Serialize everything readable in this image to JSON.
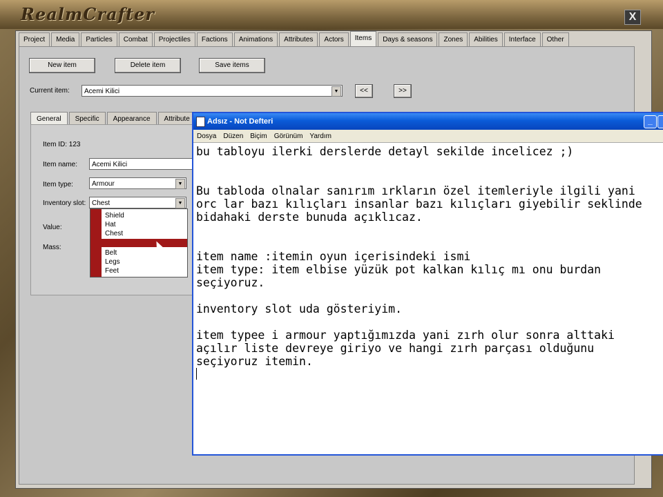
{
  "app": {
    "logo_text": "RealmCrafter",
    "close_glyph": "X"
  },
  "main_tabs": [
    "Project",
    "Media",
    "Particles",
    "Combat",
    "Projectiles",
    "Factions",
    "Animations",
    "Attributes",
    "Actors",
    "Items",
    "Days & seasons",
    "Zones",
    "Abilities",
    "Interface",
    "Other"
  ],
  "active_main_tab": "Items",
  "toolbar": {
    "new_item": "New item",
    "delete_item": "Delete item",
    "save_items": "Save items"
  },
  "current_item": {
    "label": "Current item:",
    "value": "Acemi Kilici",
    "prev": "<<",
    "next": ">>"
  },
  "sub_tabs": [
    "General",
    "Specific",
    "Appearance",
    "Attribute"
  ],
  "active_sub_tab": "General",
  "general": {
    "item_id": "Item ID: 123",
    "item_name_label": "Item name:",
    "item_name_value": "Acemi Kilici",
    "item_type_label": "Item type:",
    "item_type_value": "Armour",
    "inventory_slot_label": "Inventory slot:",
    "inventory_slot_value": "Chest",
    "value_label": "Value:",
    "mass_label": "Mass:"
  },
  "slot_options": [
    "Shield",
    "Hat",
    "Chest",
    "",
    "Belt",
    "Legs",
    "Feet"
  ],
  "notepad": {
    "title": "Adsız - Not Defteri",
    "menu": [
      "Dosya",
      "Düzen",
      "Biçim",
      "Görünüm",
      "Yardım"
    ],
    "lines": [
      "bu tabloyu ilerki derslerde detayl sekilde incelicez ;)",
      "",
      "",
      "Bu tabloda olnalar sanırım ırkların özel itemleriyle ilgili yani",
      "orc lar bazı kılıçları insanlar bazı kılıçları giyebilir seklinde",
      "bidahaki derste bunuda açıklıcaz.",
      "",
      "",
      "item name :itemin oyun içerisindeki ismi",
      "item type: item elbise yüzük pot kalkan kılıç mı onu burdan",
      "seçiyoruz.",
      "",
      "inventory slot uda gösteriyim.",
      "",
      "item typee i armour yaptığımızda yani zırh olur sonra alttaki",
      "açılır liste devreye giriyo ve hangi zırh parçası olduğunu",
      "seçiyoruz itemin."
    ]
  }
}
